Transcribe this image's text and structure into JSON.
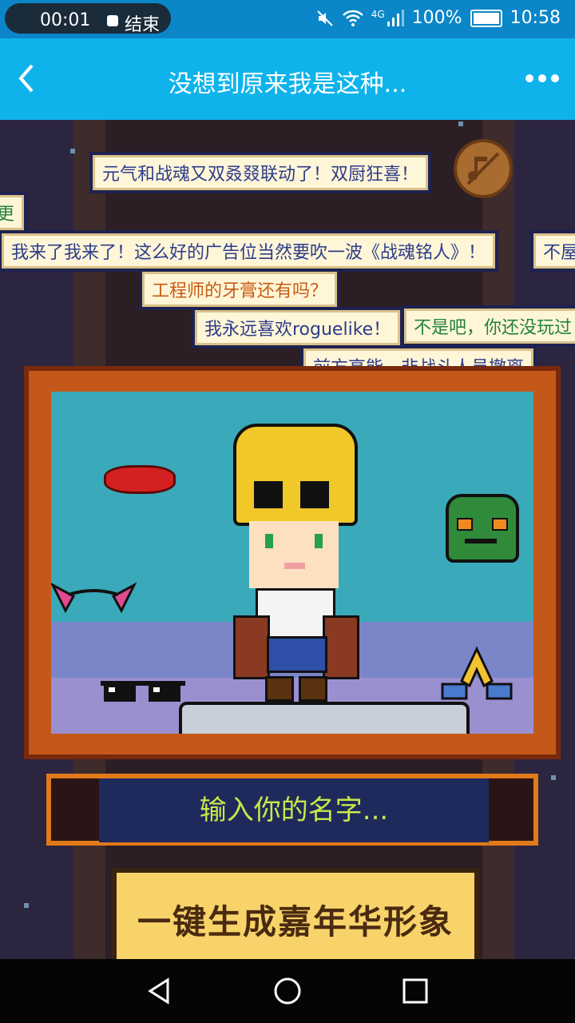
{
  "status_bar": {
    "recording_time": "00:01",
    "stop_label": "结束",
    "network": "4G",
    "battery": "100%",
    "clock": "10:58"
  },
  "app_bar": {
    "title": "没想到原来我是这种...",
    "back_icon": "chevron-left-icon",
    "more_icon": "more-dots-icon"
  },
  "danmaku": [
    {
      "text": "元气和战魂又双叒叕联动了！双厨狂喜！"
    },
    {
      "text": "更"
    },
    {
      "text": "我来了我来了！这么好的广告位当然要吹一波《战魂铭人》！"
    },
    {
      "text": "不屋午"
    },
    {
      "text": "工程师的牙膏还有吗？"
    },
    {
      "text": "我永远喜欢roguelike！"
    },
    {
      "text": "不是吧，你还没玩过"
    },
    {
      "text": "前方高能，非战斗人员撤离"
    }
  ],
  "sound_icon": "music-muted-icon",
  "accessories": [
    "lips-icon",
    "frog-mask-icon",
    "cat-ears-icon",
    "sunglasses-icon",
    "prayer-hands-icon"
  ],
  "name_input": {
    "placeholder": "输入你的名字..."
  },
  "generate_button": {
    "label": "一键生成嘉年华形象"
  },
  "nav": {
    "back": "nav-back-icon",
    "home": "nav-home-icon",
    "recents": "nav-recents-icon"
  },
  "colors": {
    "status_bar": "#0b86c8",
    "app_bar": "#0fb3ec",
    "frame": "#c4581a",
    "button": "#f7d36a"
  }
}
